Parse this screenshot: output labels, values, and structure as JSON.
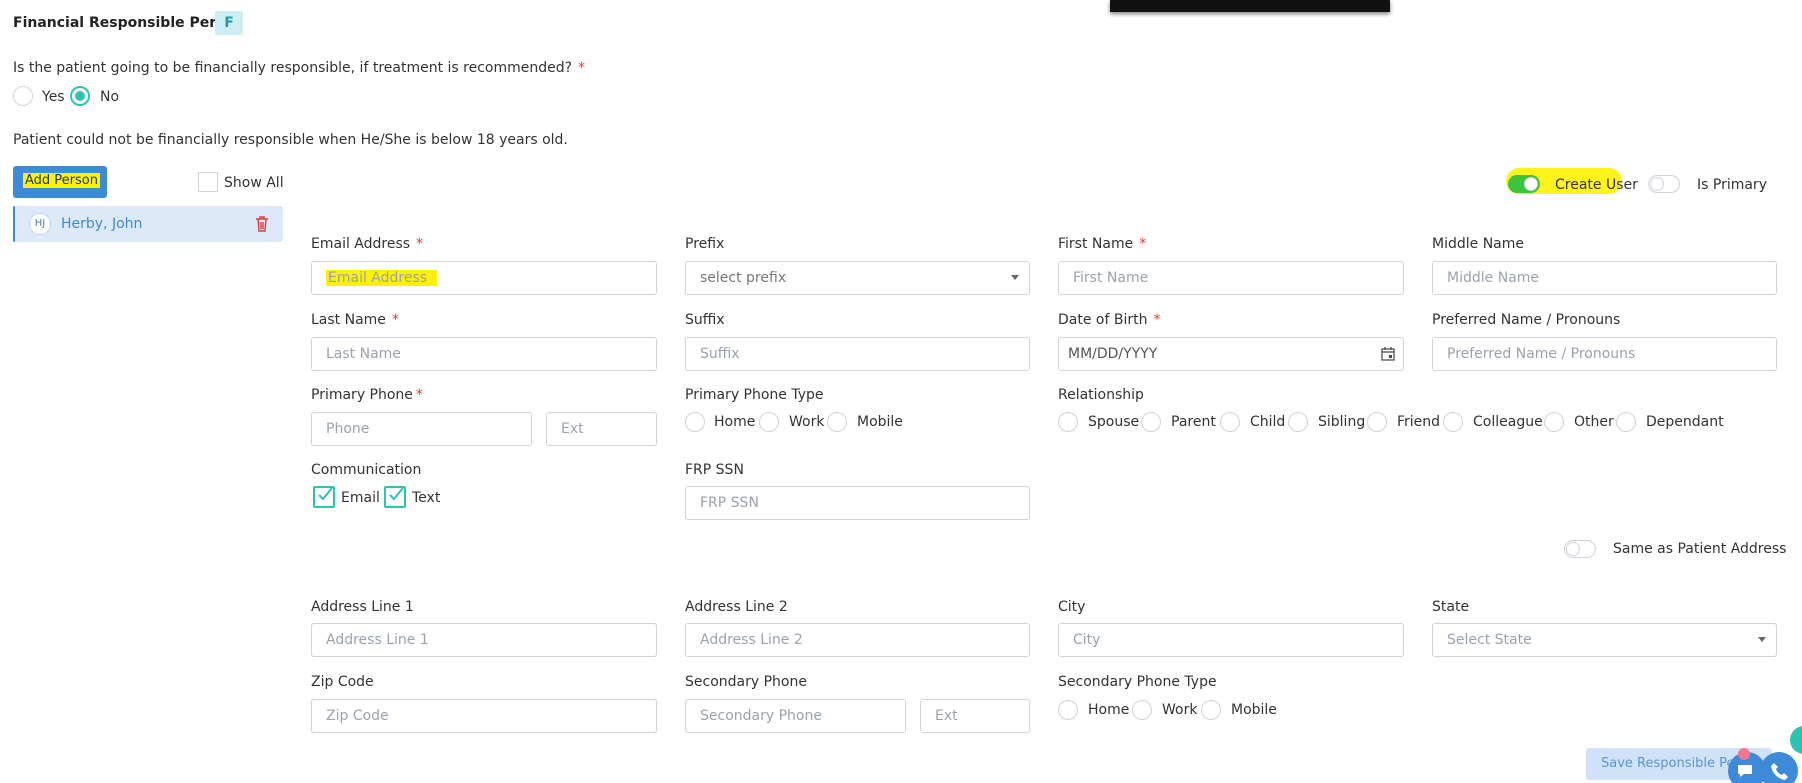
{
  "section": {
    "title": "Financial Responsible Person",
    "badge": "F"
  },
  "question": {
    "text": "Is the patient going to be financially responsible, if treatment is recommended?",
    "yes": "Yes",
    "no": "No"
  },
  "notice": "Patient could not be financially responsible when He/She is below 18 years old.",
  "sidebar": {
    "add_button": "Add Person",
    "show_all": "Show All",
    "person": {
      "initials": "HJ",
      "name": "Herby, John"
    }
  },
  "toggles": {
    "create_user": "Create User",
    "is_primary": "Is Primary",
    "same_address": "Same as Patient Address"
  },
  "form": {
    "email": {
      "label": "Email Address",
      "placeholder": "Email Address"
    },
    "prefix": {
      "label": "Prefix",
      "placeholder": "select prefix"
    },
    "first_name": {
      "label": "First Name",
      "placeholder": "First Name"
    },
    "middle_name": {
      "label": "Middle Name",
      "placeholder": "Middle Name"
    },
    "last_name": {
      "label": "Last Name",
      "placeholder": "Last Name"
    },
    "suffix": {
      "label": "Suffix",
      "placeholder": "Suffix"
    },
    "dob": {
      "label": "Date of Birth",
      "placeholder": "MM/DD/YYYY"
    },
    "preferred": {
      "label": "Preferred Name / Pronouns",
      "placeholder": "Preferred Name / Pronouns"
    },
    "primary_phone": {
      "label": "Primary Phone",
      "placeholder": "Phone",
      "ext": "Ext"
    },
    "primary_phone_type": {
      "label": "Primary Phone Type",
      "options": [
        "Home",
        "Work",
        "Mobile"
      ]
    },
    "relationship": {
      "label": "Relationship",
      "options": [
        "Spouse",
        "Parent",
        "Child",
        "Sibling",
        "Friend",
        "Colleague",
        "Other",
        "Dependant"
      ]
    },
    "communication": {
      "label": "Communication",
      "email": "Email",
      "text": "Text"
    },
    "frp_ssn": {
      "label": "FRP SSN",
      "placeholder": "FRP SSN"
    },
    "address1": {
      "label": "Address Line 1",
      "placeholder": "Address Line 1"
    },
    "address2": {
      "label": "Address Line 2",
      "placeholder": "Address Line 2"
    },
    "city": {
      "label": "City",
      "placeholder": "City"
    },
    "state": {
      "label": "State",
      "placeholder": "Select State"
    },
    "zip": {
      "label": "Zip Code",
      "placeholder": "Zip Code"
    },
    "secondary_phone": {
      "label": "Secondary Phone",
      "placeholder": "Secondary Phone",
      "ext": "Ext"
    },
    "secondary_phone_type": {
      "label": "Secondary Phone Type",
      "options": [
        "Home",
        "Work",
        "Mobile"
      ]
    }
  },
  "save_button": "Save Responsible Person",
  "colors": {
    "accent": "#2bc4b3",
    "primary": "#3d8bd8",
    "highlight": "#fff200",
    "required": "#e53935"
  }
}
